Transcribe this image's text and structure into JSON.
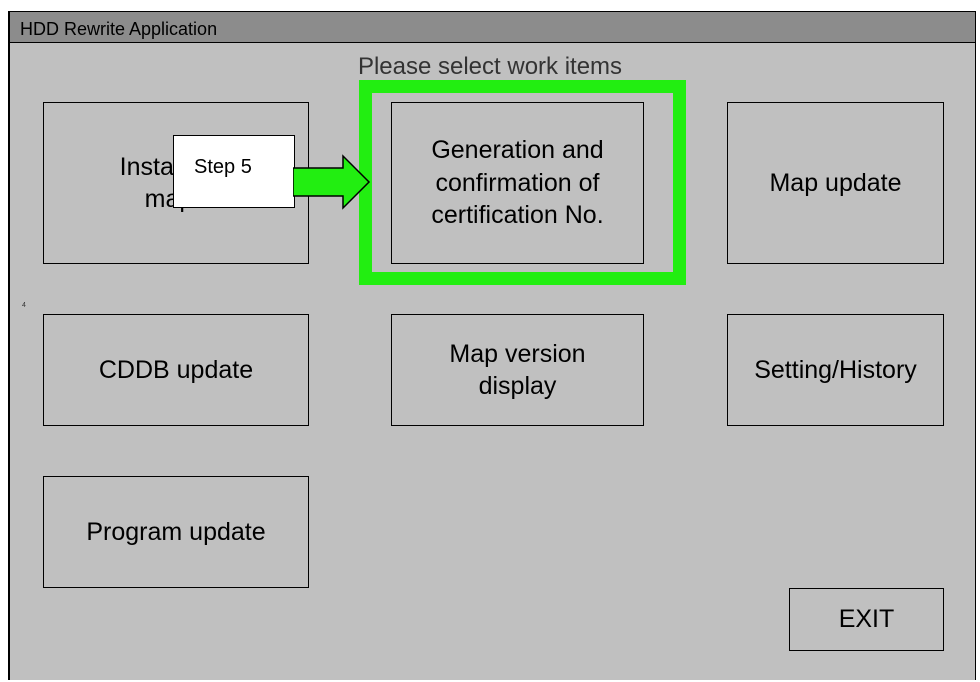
{
  "window": {
    "title": "HDD Rewrite Application"
  },
  "main": {
    "heading": "Please select work items",
    "buttons": {
      "installing_map": "Installing\nmap",
      "generation_cert": "Generation and\nconfirmation of\ncertification No.",
      "map_update": "Map update",
      "cddb_update": "CDDB update",
      "map_version_display": "Map version\ndisplay",
      "setting_history": "Setting/History",
      "program_update": "Program update",
      "exit": "EXIT"
    },
    "stray_mark": "4"
  },
  "annotation": {
    "step_label": "Step 5",
    "highlight_color": "#22ee11",
    "arrow_color": "#22ee11"
  }
}
